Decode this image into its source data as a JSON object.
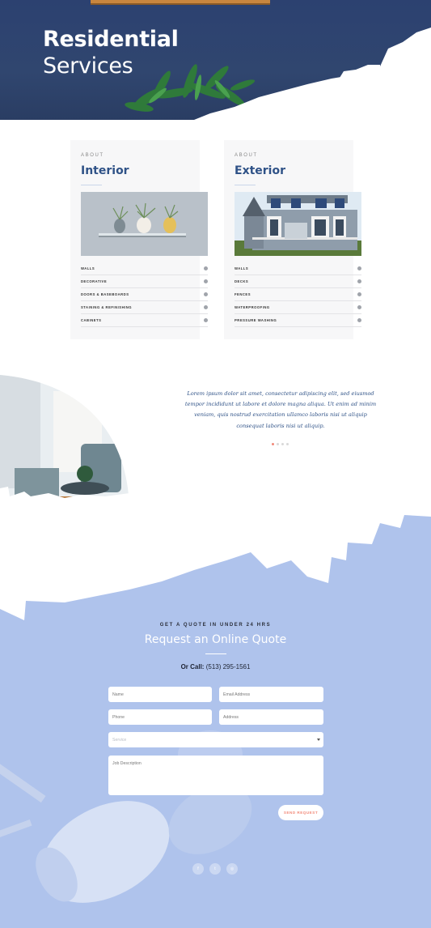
{
  "hero": {
    "title_line1": "Residential",
    "title_line2": "Services"
  },
  "cards": [
    {
      "eyebrow": "ABOUT",
      "title": "Interior",
      "items": [
        "WALLS",
        "DECORATIVE",
        "DOORS & BASEBOARDS",
        "STAINING & REFINISHING",
        "CABINETS"
      ]
    },
    {
      "eyebrow": "ABOUT",
      "title": "Exterior",
      "items": [
        "WALLS",
        "DECKS",
        "FENCES",
        "WATERPROOFING",
        "PRESSURE WASHING"
      ]
    }
  ],
  "testimonial": {
    "text": "Lorem ipsum dolor sit amet, consectetur adipiscing elit, sed eiusmod tempor incididunt ut labore et dolore magna aliqua. Ut enim ad minim veniam, quis nostrud exercitation ullamco laboris nisi ut aliquip consequat laboris nisi ut aliquip.",
    "active_slide": 1,
    "slide_count": 4
  },
  "quote_form": {
    "eyebrow": "GET A QUOTE IN UNDER 24 HRS",
    "title": "Request an Online Quote",
    "call_label": "Or Call:",
    "phone": "(513) 295-1561",
    "fields": {
      "name": "Name",
      "email": "Email Address",
      "phone": "Phone",
      "address": "Address",
      "service": "Service",
      "description": "Job Description"
    },
    "submit_label": "SEND REQUEST"
  },
  "social": {
    "facebook": "f",
    "twitter": "t",
    "instagram": "◎"
  },
  "colors": {
    "hero_bg": "#2c4170",
    "accent_blue": "#2f5287",
    "quote_bg": "#b5c9ee",
    "coral": "#f28a7a"
  }
}
